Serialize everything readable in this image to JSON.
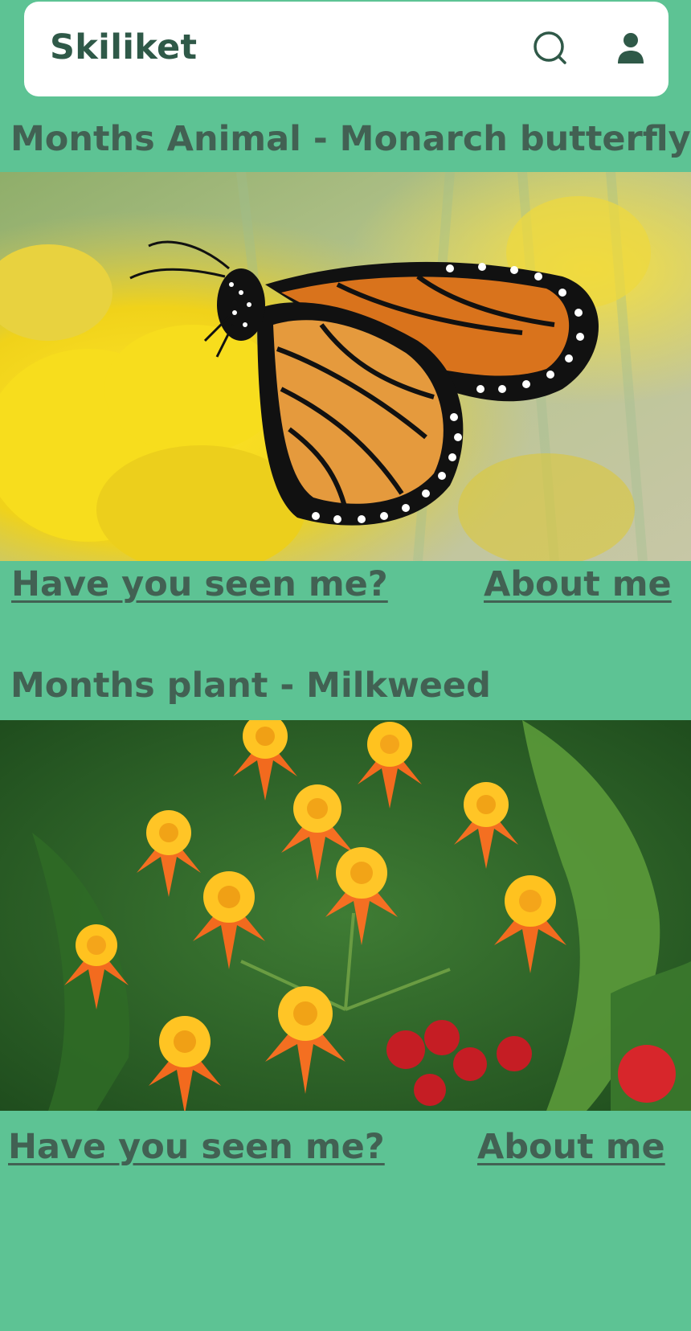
{
  "header": {
    "app_title": "Skiliket",
    "search_icon": "search-icon",
    "user_icon": "user-icon"
  },
  "animal_section": {
    "title": "Months Animal - Monarch butterfly",
    "image_subject": "monarch butterfly on yellow flowers",
    "seen_link": "Have you seen me?",
    "about_link": "About me"
  },
  "plant_section": {
    "title": "Months plant - Milkweed",
    "image_subject": "orange milkweed flowers",
    "seen_link": "Have you seen me?",
    "about_link": "About me"
  },
  "colors": {
    "background": "#5dc394",
    "header_bg": "#ffffff",
    "text": "#426153",
    "title_text": "#2f5948"
  }
}
